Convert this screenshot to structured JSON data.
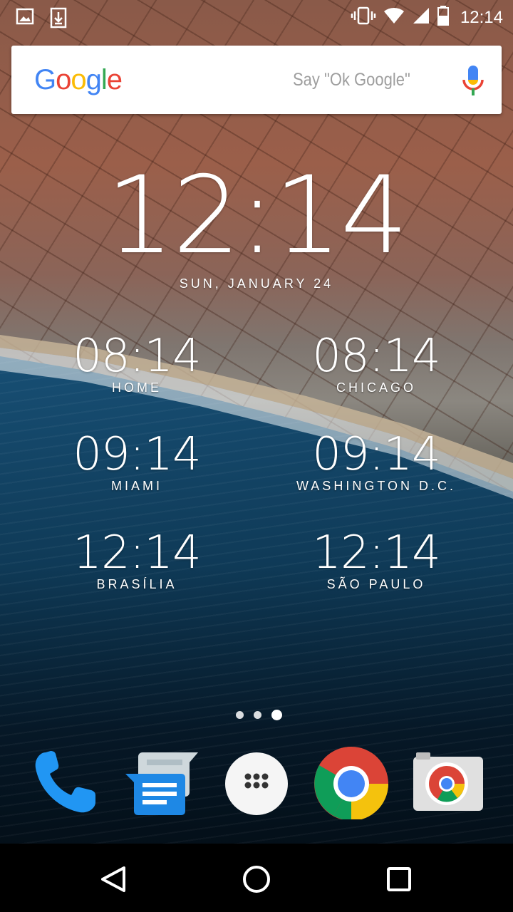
{
  "status_bar": {
    "time": "12:14",
    "left_icons": [
      "image-notification-icon",
      "download-notification-icon"
    ],
    "right_icons": [
      "vibrate-icon",
      "wifi-icon",
      "cell-signal-icon",
      "battery-icon"
    ]
  },
  "search": {
    "logo_letters": [
      {
        "char": "G",
        "color": "#4285F4"
      },
      {
        "char": "o",
        "color": "#EA4335"
      },
      {
        "char": "o",
        "color": "#FBBC05"
      },
      {
        "char": "g",
        "color": "#4285F4"
      },
      {
        "char": "l",
        "color": "#34A853"
      },
      {
        "char": "e",
        "color": "#EA4335"
      }
    ],
    "hint": "Say \"Ok Google\""
  },
  "clock": {
    "time": "12:14",
    "date": "SUN, JANUARY 24"
  },
  "world_clocks": [
    {
      "time": "08:14",
      "city": "HOME"
    },
    {
      "time": "08:14",
      "city": "CHICAGO"
    },
    {
      "time": "09:14",
      "city": "MIAMI"
    },
    {
      "time": "09:14",
      "city": "WASHINGTON D.C."
    },
    {
      "time": "12:14",
      "city": "BRASÍLIA"
    },
    {
      "time": "12:14",
      "city": "SÃO PAULO"
    }
  ],
  "page_indicator": {
    "pages": 3,
    "current": 3
  },
  "dock": [
    "phone-icon",
    "messenger-icon",
    "app-drawer-icon",
    "chrome-icon",
    "camera-icon"
  ],
  "colors": {
    "phone": "#2196F3",
    "messenger": "#1E88E5",
    "chrome_red": "#DB4437",
    "chrome_yellow": "#F4C20D",
    "chrome_green": "#0F9D58",
    "chrome_blue": "#4285F4"
  }
}
